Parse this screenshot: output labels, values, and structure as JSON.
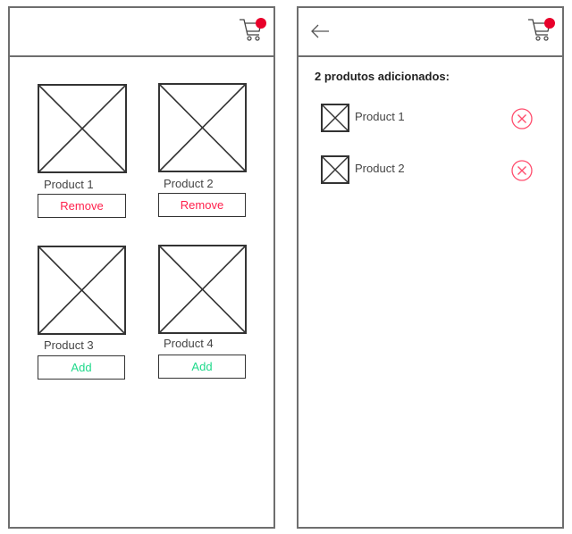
{
  "screens": {
    "catalog": {
      "cart_badge_color": "#e8002a",
      "products": [
        {
          "name": "Product 1",
          "action": "Remove",
          "action_type": "remove"
        },
        {
          "name": "Product 2",
          "action": "Remove",
          "action_type": "remove"
        },
        {
          "name": "Product 3",
          "action": "Add",
          "action_type": "add"
        },
        {
          "name": "Product 4",
          "action": "Add",
          "action_type": "add"
        }
      ]
    },
    "cart": {
      "back_icon": "arrow-left-icon",
      "heading": "2 produtos adicionados:",
      "items": [
        {
          "name": "Product 1",
          "remove_icon": "circle-x-icon"
        },
        {
          "name": "Product 2",
          "remove_icon": "circle-x-icon"
        }
      ]
    }
  },
  "colors": {
    "remove": "#ff1f4b",
    "add": "#1ed98a",
    "badge": "#e8002a"
  }
}
